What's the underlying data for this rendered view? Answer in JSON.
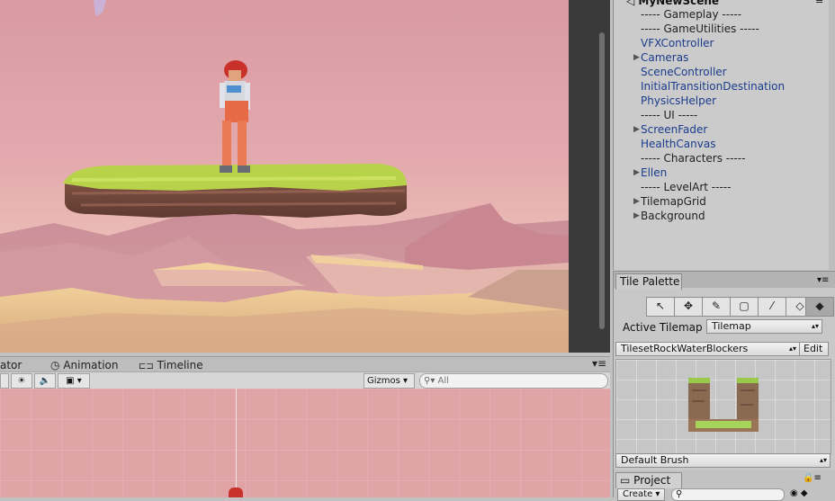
{
  "hierarchy": {
    "scene_name": "MyNewScene",
    "rows": [
      {
        "label": "----- Gameplay -----",
        "blue": false,
        "arrow": false
      },
      {
        "label": "----- GameUtilities -----",
        "blue": false,
        "arrow": false
      },
      {
        "label": "VFXController",
        "blue": true,
        "arrow": false
      },
      {
        "label": "Cameras",
        "blue": true,
        "arrow": true
      },
      {
        "label": "SceneController",
        "blue": true,
        "arrow": false
      },
      {
        "label": "InitialTransitionDestination",
        "blue": true,
        "arrow": false
      },
      {
        "label": "PhysicsHelper",
        "blue": true,
        "arrow": false
      },
      {
        "label": "----- UI -----",
        "blue": false,
        "arrow": false
      },
      {
        "label": "ScreenFader",
        "blue": true,
        "arrow": true
      },
      {
        "label": "HealthCanvas",
        "blue": true,
        "arrow": false
      },
      {
        "label": "----- Characters -----",
        "blue": false,
        "arrow": false
      },
      {
        "label": "Ellen",
        "blue": true,
        "arrow": true
      },
      {
        "label": "----- LevelArt -----",
        "blue": false,
        "arrow": false
      },
      {
        "label": "TilemapGrid",
        "blue": false,
        "arrow": true
      },
      {
        "label": "Background",
        "blue": false,
        "arrow": true
      }
    ]
  },
  "tile_palette": {
    "tab_label": "Tile Palette",
    "tools": [
      "select-icon",
      "move-icon",
      "brush-icon",
      "box-fill-icon",
      "picker-icon",
      "eraser-icon",
      "fill-icon"
    ],
    "active_tilemap_label": "Active Tilemap",
    "active_tilemap_value": "Tilemap",
    "palette_value": "TilesetRockWaterBlockers",
    "edit_label": "Edit",
    "brush_value": "Default Brush"
  },
  "scene_panel": {
    "tabs": [
      "ator",
      "Animation",
      "Timeline"
    ],
    "gizmos_label": "Gizmos",
    "search_placeholder": "All"
  },
  "project": {
    "tab_label": "Project",
    "create_label": "Create"
  },
  "colors": {
    "hierarchy_blue": "#1a3c8c",
    "sky_pink": "#e3a9ae",
    "grass": "#b8d34a"
  }
}
